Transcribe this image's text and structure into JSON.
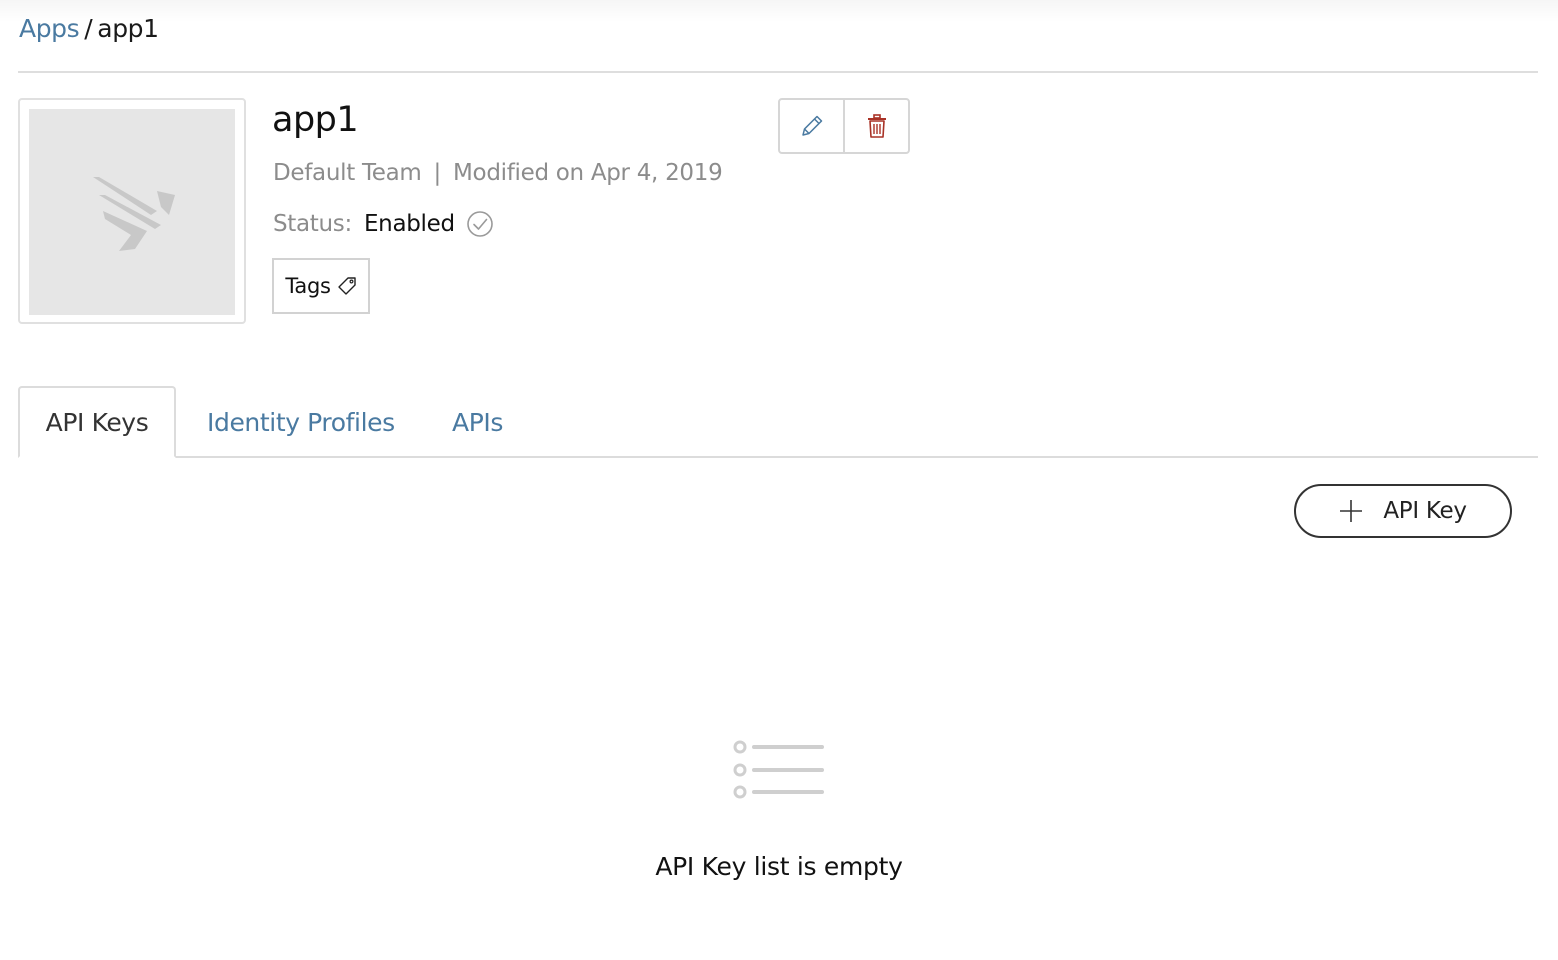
{
  "breadcrumb": {
    "parent_label": "Apps",
    "separator": "/",
    "current_label": "app1"
  },
  "app": {
    "title": "app1",
    "team": "Default Team",
    "meta_separator": "|",
    "modified": "Modified on Apr 4, 2019",
    "status_label": "Status:",
    "status_value": "Enabled",
    "tags_label": "Tags",
    "logo_icon": "app-placeholder-logo-icon"
  },
  "actions": {
    "edit_icon": "pencil-icon",
    "delete_icon": "trash-icon"
  },
  "tabs": [
    {
      "label": "API Keys",
      "active": true
    },
    {
      "label": "Identity Profiles",
      "active": false
    },
    {
      "label": "APIs",
      "active": false
    }
  ],
  "api_keys": {
    "add_label": "API Key",
    "empty_message": "API Key list is empty",
    "empty_icon": "list-icon"
  },
  "colors": {
    "link": "#4a7aa1",
    "delete": "#a93226",
    "muted_text": "#8c8c8c"
  }
}
